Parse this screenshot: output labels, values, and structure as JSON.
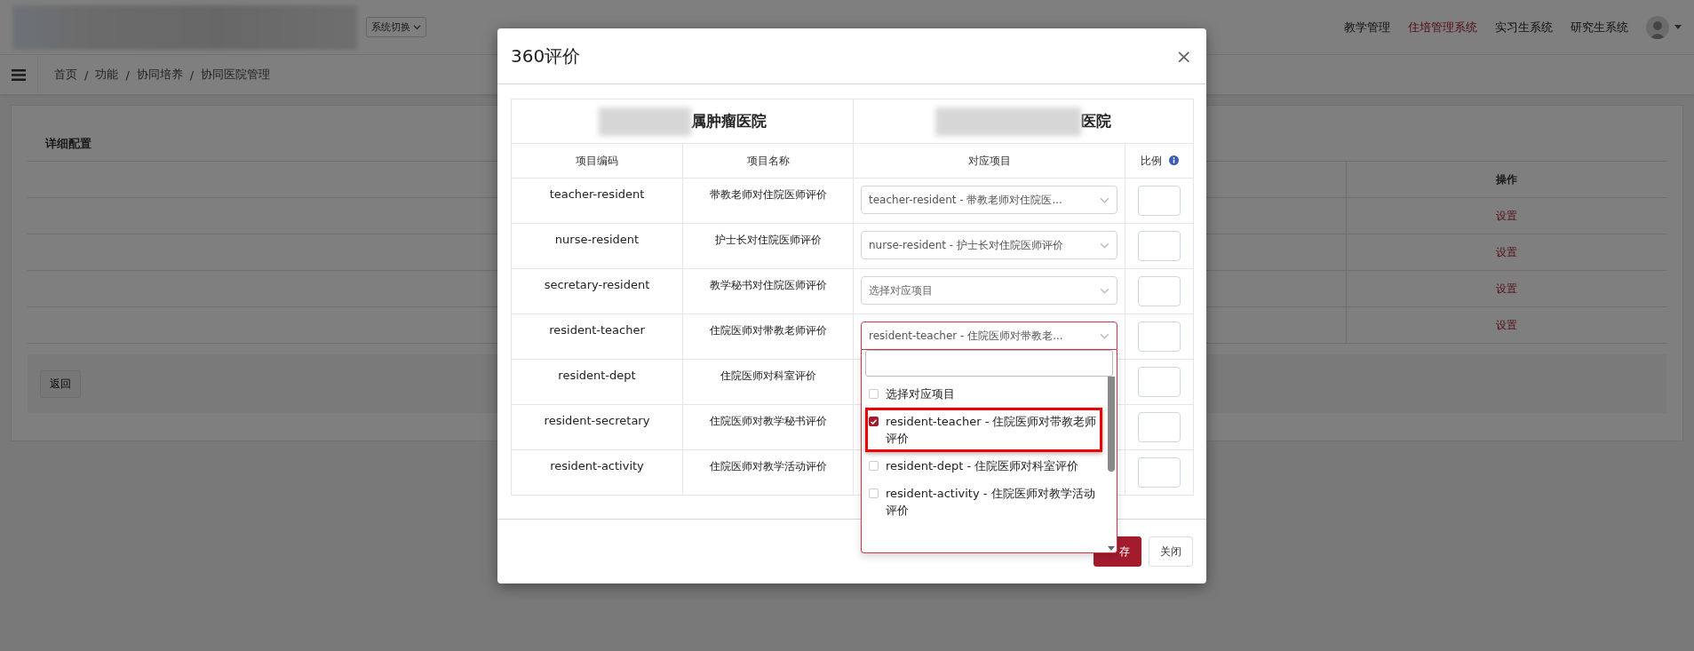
{
  "header": {
    "system_switch": "系统切换",
    "nav": [
      {
        "label": "教学管理",
        "selected": false
      },
      {
        "label": "住培管理系统",
        "selected": true
      },
      {
        "label": "实习生系统",
        "selected": false
      },
      {
        "label": "研究生系统",
        "selected": false
      }
    ]
  },
  "breadcrumb": [
    "首页",
    "/",
    "功能",
    "/",
    "协同培养",
    "/",
    "协同医院管理"
  ],
  "panel": {
    "title": "详细配置",
    "action_header": "操作",
    "rows": [
      {
        "action": "设置"
      },
      {
        "action": "设置"
      },
      {
        "action": "设置"
      },
      {
        "action": "设置"
      }
    ],
    "back_button": "返回"
  },
  "modal": {
    "title": "360评价",
    "close": "×",
    "hospitals": [
      "属肿瘤医院",
      "医院"
    ],
    "columns": [
      "项目编码",
      "项目名称",
      "对应项目",
      "比例"
    ],
    "rows": [
      {
        "code": "teacher-resident",
        "name": "带教老师对住院医师评价",
        "mapping": {
          "value": "teacher-resident - 带教老师对住院医..."
        },
        "open": false
      },
      {
        "code": "nurse-resident",
        "name": "护士长对住院医师评价",
        "mapping": {
          "value": "nurse-resident - 护士长对住院医师评价"
        },
        "open": false
      },
      {
        "code": "secretary-resident",
        "name": "教学秘书对住院医师评价",
        "mapping": {
          "placeholder": "选择对应项目"
        },
        "open": false
      },
      {
        "code": "resident-teacher",
        "name": "住院医师对带教老师评价",
        "mapping": {
          "value": "resident-teacher - 住院医师对带教老..."
        },
        "open": true
      },
      {
        "code": "resident-dept",
        "name": "住院医师对科室评价"
      },
      {
        "code": "resident-secretary",
        "name": "住院医师对教学秘书评价"
      },
      {
        "code": "resident-activity",
        "name": "住院医师对教学活动评价"
      }
    ],
    "dropdown": {
      "options": [
        {
          "label": "选择对应项目",
          "checked": false,
          "highlighted": false
        },
        {
          "label": "resident-teacher - 住院医师对带教老师评价",
          "checked": true,
          "highlighted": true
        },
        {
          "label": "resident-dept - 住院医师对科室评价",
          "checked": false,
          "highlighted": false
        },
        {
          "label": "resident-activity - 住院医师对教学活动评价",
          "checked": false,
          "highlighted": false
        }
      ]
    },
    "buttons": [
      {
        "label": "存",
        "kind": "primary"
      },
      {
        "label": "关闭",
        "kind": "default"
      }
    ]
  }
}
